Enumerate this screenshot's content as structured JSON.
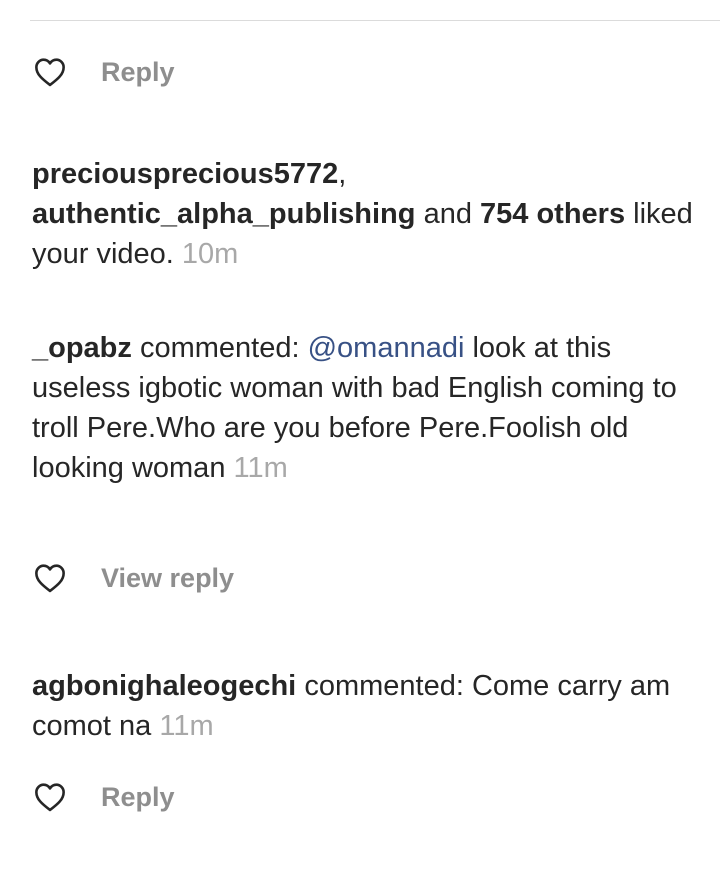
{
  "row1": {
    "reply_label": "Reply"
  },
  "like_notification": {
    "user1": "preciousprecious5772",
    "sep1": ",",
    "user2": "authentic_alpha_publishing",
    "and_text": "and",
    "count_text": "754 others",
    "liked_text": "liked your video.",
    "time": "10m"
  },
  "comment1": {
    "user": "_opabz",
    "verb": "commented:",
    "mention": "@omannadi",
    "text": "look at this useless igbotic woman with bad English coming to troll Pere.Who are you before Pere.Foolish old looking woman",
    "time": "11m",
    "reply_label": "View reply"
  },
  "comment2": {
    "user": "agbonighaleogechi",
    "verb": "commented:",
    "text": "Come carry am comot na",
    "time": "11m",
    "reply_label": "Reply"
  },
  "colors": {
    "username": "#262626",
    "mention": "#385185",
    "meta": "#8e8e8e",
    "timestamp": "#a8a8a8"
  }
}
